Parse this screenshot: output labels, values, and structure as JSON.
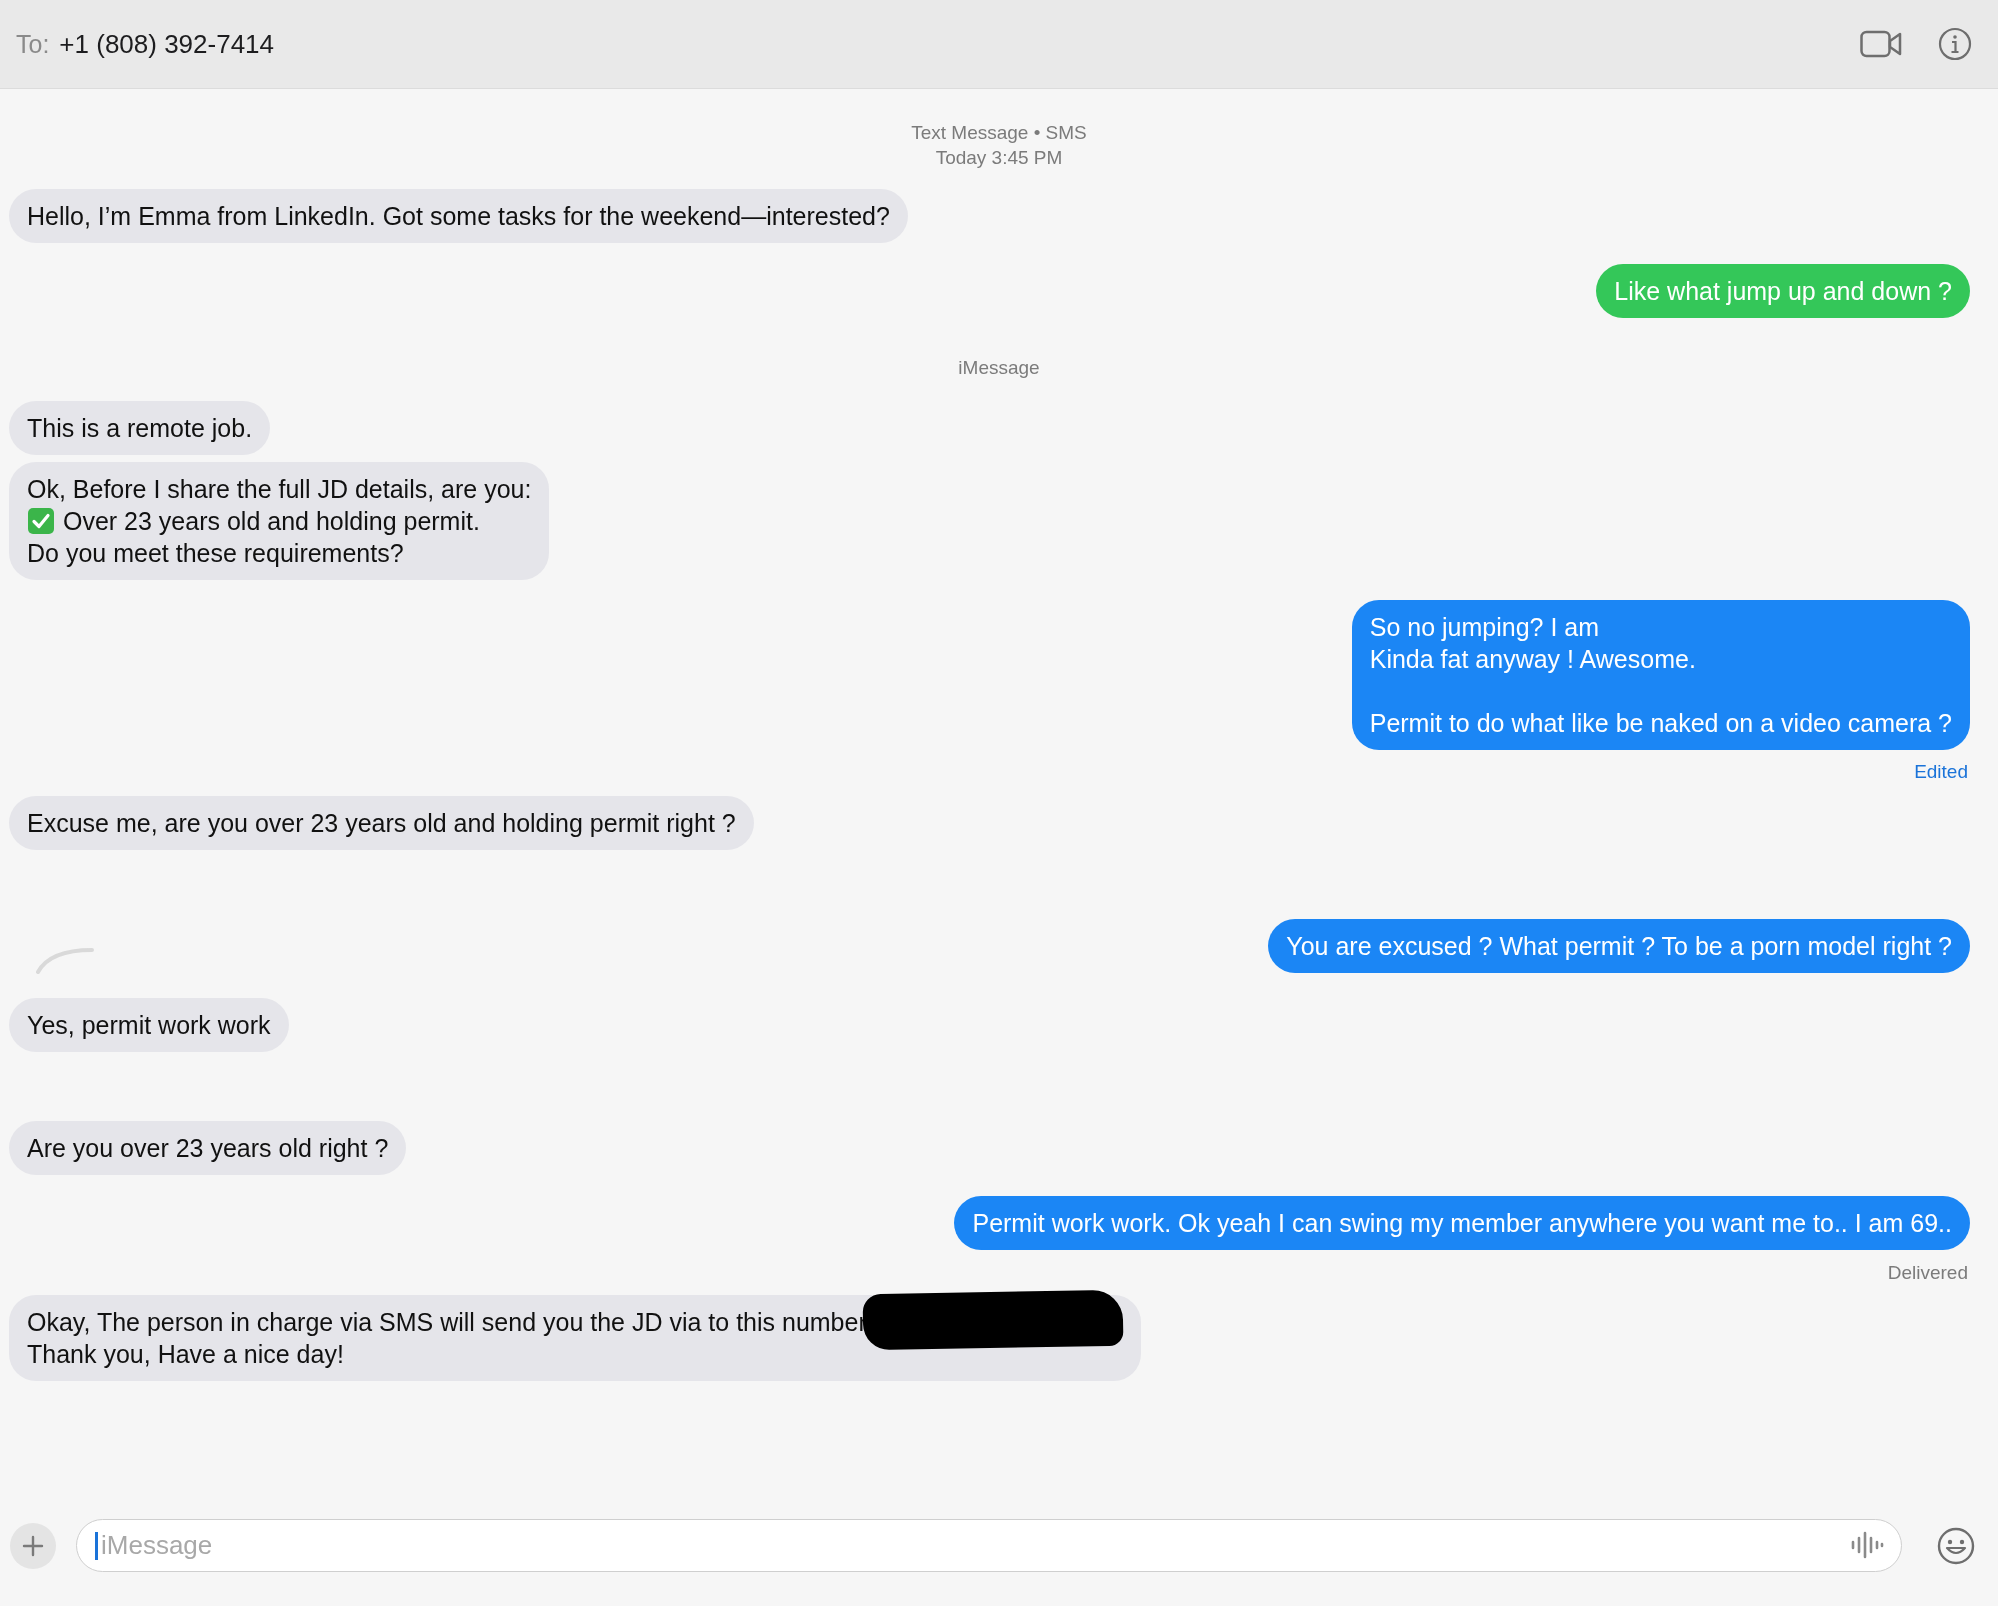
{
  "header": {
    "to_label": "To:",
    "recipient": "+1 (808) 392-7414"
  },
  "messages": [
    {
      "kind": "meta",
      "lines": [
        "Text Message • SMS",
        "Today 3:45 PM"
      ]
    },
    {
      "kind": "incoming",
      "lines": [
        {
          "kind": "plain",
          "text": "Hello, I’m Emma from LinkedIn. Got some tasks for the weekend—interested?"
        }
      ]
    },
    {
      "kind": "outgoing",
      "color": "#34c759",
      "text": "Like what jump up and down ?"
    },
    {
      "kind": "meta",
      "lines": [
        "iMessage"
      ]
    },
    {
      "kind": "incoming",
      "lines": [
        {
          "kind": "plain",
          "text": "This is a remote job."
        }
      ]
    },
    {
      "kind": "incoming",
      "lines": [
        {
          "kind": "plain",
          "text": "Ok, Before I share the full JD details, are you:"
        },
        {
          "kind": "check",
          "text": "Over 23 years old and holding permit."
        },
        {
          "kind": "plain",
          "text": "Do you meet these requirements?"
        }
      ]
    },
    {
      "kind": "outgoing",
      "color": "#1b86f5",
      "text": "So no jumping? I am\nKinda fat anyway ! Awesome.\n\nPermit to do what like be naked on a video camera ?"
    },
    {
      "kind": "status",
      "highlighted": true,
      "text": "Edited"
    },
    {
      "kind": "incoming",
      "lines": [
        {
          "kind": "plain",
          "text": "Excuse me, are you over 23 years old and holding permit right ?"
        }
      ]
    },
    {
      "kind": "outgoing",
      "color": "#1b86f5",
      "text": "You are excused ? What permit ? To be a porn model right ?"
    },
    {
      "kind": "incoming",
      "lines": [
        {
          "kind": "plain",
          "text": "Yes, permit work work"
        }
      ]
    },
    {
      "kind": "incoming",
      "lines": [
        {
          "kind": "plain",
          "text": "Are you over 23 years old  right ?"
        }
      ]
    },
    {
      "kind": "outgoing",
      "color": "#1b86f5",
      "text": "Permit work work. Ok yeah I can swing my member anywhere you want me to.. I am 69.."
    },
    {
      "kind": "status",
      "highlighted": false,
      "text": "Delivered"
    },
    {
      "kind": "incoming",
      "redacted": true,
      "lines": [
        {
          "kind": "plain",
          "text": "Okay, The person in charge via SMS will send you the JD via to this number"
        },
        {
          "kind": "plain",
          "text": "Thank you, Have a nice day!"
        }
      ]
    }
  ],
  "compose": {
    "placeholder": "iMessage"
  }
}
